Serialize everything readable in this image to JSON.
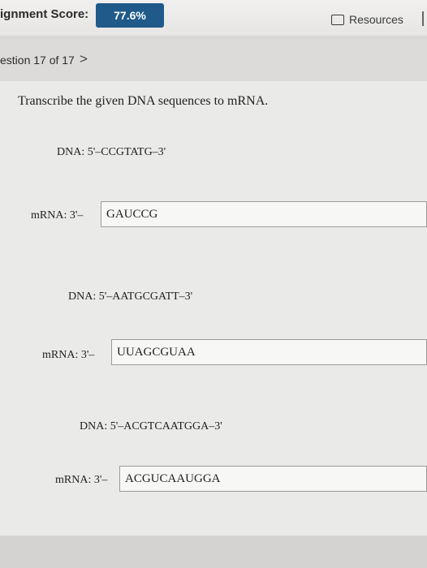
{
  "header": {
    "score_label": "ignment Score:",
    "score_value": "77.6%",
    "resources_label": "Resources"
  },
  "nav": {
    "question_label": "estion 17 of 17",
    "next_glyph": ">"
  },
  "main": {
    "instruction": "Transcribe the given DNA sequences to mRNA.",
    "items": [
      {
        "dna": "DNA: 5'–CCGTATG–3'",
        "mrna_label": "mRNA: 3'–",
        "answer": "GAUCCG"
      },
      {
        "dna": "DNA: 5'–AATGCGATT–3'",
        "mrna_label": "mRNA: 3'–",
        "answer": "UUAGCGUAA"
      },
      {
        "dna": "DNA: 5'–ACGTCAATGGA–3'",
        "mrna_label": "mRNA: 3'–",
        "answer": "ACGUCAAUGGA"
      }
    ]
  }
}
